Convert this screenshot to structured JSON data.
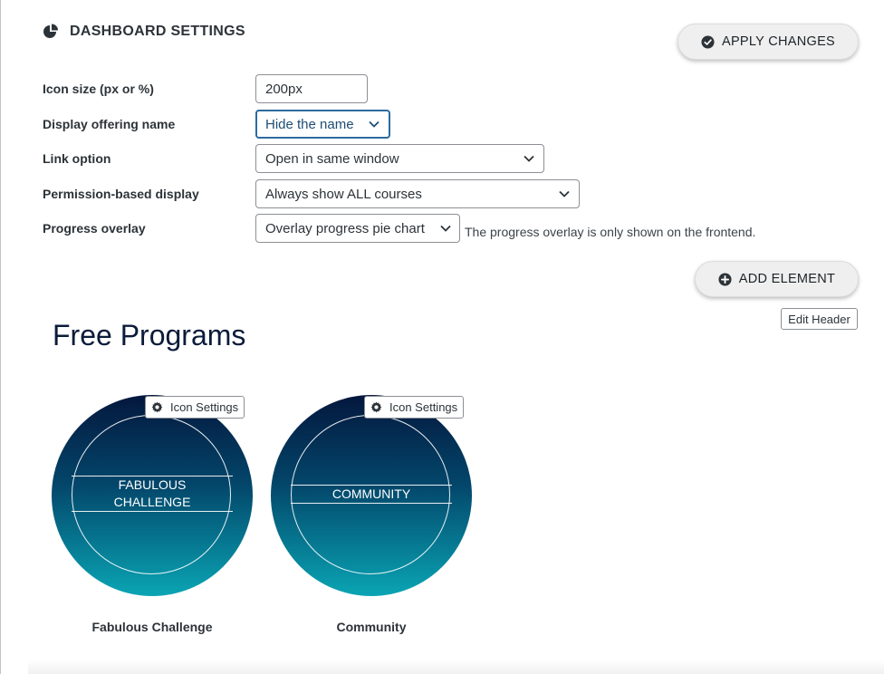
{
  "header": {
    "title": "DASHBOARD SETTINGS",
    "icon": "pie-chart-icon"
  },
  "toolbar": {
    "apply_label": "APPLY CHANGES",
    "add_element_label": "ADD ELEMENT",
    "edit_header_label": "Edit Header"
  },
  "settings": {
    "icon_size": {
      "label": "Icon size (px or %)",
      "value": "200px"
    },
    "display_name": {
      "label": "Display offering name",
      "value": "Hide the name"
    },
    "link_option": {
      "label": "Link option",
      "value": "Open in same window"
    },
    "permission": {
      "label": "Permission-based display",
      "value": "Always show ALL courses"
    },
    "progress": {
      "label": "Progress overlay",
      "value": "Overlay progress pie chart",
      "note": "The progress overlay is only shown on the frontend."
    }
  },
  "section": {
    "title": "Free Programs"
  },
  "offerings": [
    {
      "icon_name_line1": "FABULOUS",
      "icon_name_line2": "CHALLENGE",
      "caption": "Fabulous Challenge",
      "settings_label": "Icon Settings"
    },
    {
      "icon_name_line1": "COMMUNITY",
      "caption": "Community",
      "settings_label": "Icon Settings"
    }
  ],
  "colors": {
    "gradient_top": "#04173d",
    "gradient_bottom": "#0aa5b4",
    "focus_border": "#2c6ba0"
  }
}
